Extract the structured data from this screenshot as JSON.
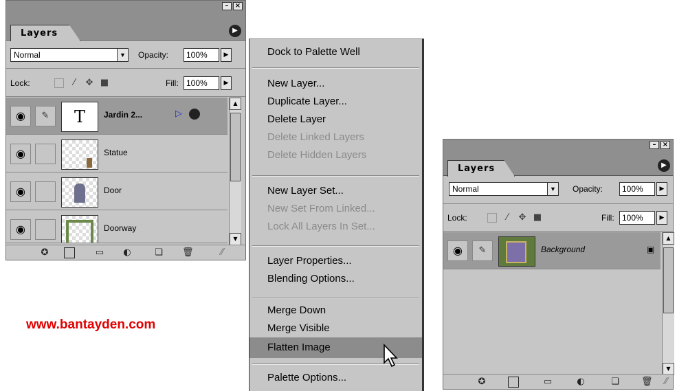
{
  "panel_left": {
    "tab": "Layers",
    "blend_mode": "Normal",
    "opacity_label": "Opacity:",
    "opacity_value": "100%",
    "lock_label": "Lock:",
    "fill_label": "Fill:",
    "fill_value": "100%",
    "layers": [
      {
        "name": "Jardin 2...",
        "type": "text",
        "thumb_text": "T",
        "selected": true
      },
      {
        "name": "Statue",
        "type": "image",
        "selected": false
      },
      {
        "name": "Door",
        "type": "image",
        "selected": false
      },
      {
        "name": "Doorway",
        "type": "image",
        "selected": false
      }
    ]
  },
  "menu": {
    "items": [
      {
        "label": "Dock to Palette Well",
        "enabled": true
      },
      {
        "label": "New Layer...",
        "enabled": true
      },
      {
        "label": "Duplicate Layer...",
        "enabled": true
      },
      {
        "label": "Delete Layer",
        "enabled": true
      },
      {
        "label": "Delete Linked Layers",
        "enabled": false
      },
      {
        "label": "Delete Hidden Layers",
        "enabled": false
      },
      {
        "label": "New Layer Set...",
        "enabled": true
      },
      {
        "label": "New Set From Linked...",
        "enabled": false
      },
      {
        "label": "Lock All Layers In Set...",
        "enabled": false
      },
      {
        "label": "Layer Properties...",
        "enabled": true
      },
      {
        "label": "Blending Options...",
        "enabled": true
      },
      {
        "label": "Merge Down",
        "enabled": true
      },
      {
        "label": "Merge Visible",
        "enabled": true
      },
      {
        "label": "Flatten Image",
        "enabled": true,
        "highlighted": true
      },
      {
        "label": "Palette Options...",
        "enabled": true
      }
    ]
  },
  "panel_right": {
    "tab": "Layers",
    "blend_mode": "Normal",
    "opacity_label": "Opacity:",
    "opacity_value": "100%",
    "lock_label": "Lock:",
    "fill_label": "Fill:",
    "fill_value": "100%",
    "layers": [
      {
        "name": "Background",
        "locked": true
      }
    ]
  },
  "watermark_text": "www.bantayden.com",
  "colors": {
    "panel_bg": "#c6c6c6",
    "highlight": "#8c8c8c",
    "watermark": "#e00000"
  }
}
